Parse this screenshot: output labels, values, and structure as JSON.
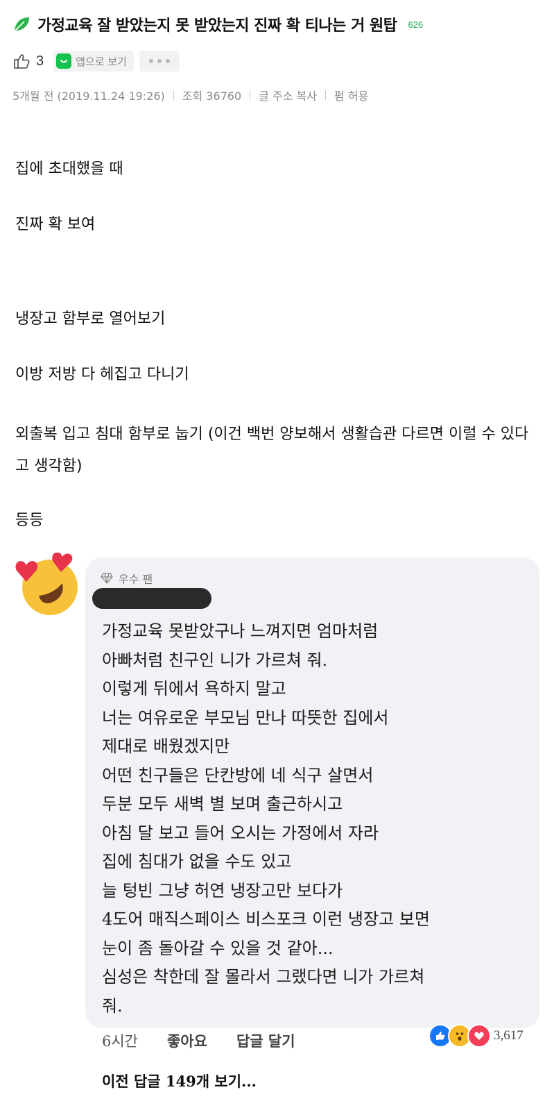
{
  "post": {
    "title": "가정교육 잘 받았는지 못 받았는지 진짜 확 티나는 거 원탑",
    "title_count": "626",
    "like_count": "3",
    "app_view_label": "앱으로 보기",
    "meta": {
      "time": "5개월 전 (2019.11.24 19:26)",
      "views": "조회 36760",
      "copy_link": "글 주소 복사",
      "share_permission": "펌 허용"
    },
    "body": {
      "p1": "집에 초대했을 때",
      "p2": "진짜 확 보여",
      "p3": "냉장고 함부로 열어보기",
      "p4": "이방 저방 다 헤집고 다니기",
      "p5": "외출복 입고 침대 함부로 눕기 (이건 백번 양보해서 생활습관 다르면 이럴 수 있다고 생각함)",
      "p6": "등등"
    }
  },
  "comment": {
    "badge": "우수 팬",
    "text": "가정교육 못받았구나 느껴지면 엄마처럼\n아빠처럼 친구인 니가 가르쳐 줘.\n이렇게 뒤에서 욕하지 말고\n너는 여유로운 부모님 만나 따뜻한 집에서\n제대로 배웠겠지만\n어떤 친구들은 단칸방에 네 식구 살면서\n두분 모두 새벽 별 보며 출근하시고\n아침 달 보고 들어 오시는 가정에서 자라\n집에 침대가 없을 수도 있고\n늘 텅빈 그냥 허연 냉장고만 보다가\n4도어 매직스페이스 비스포크 이런 냉장고 보면\n눈이 좀 돌아갈 수 있을 것 같아...\n심성은 착한데 잘 몰라서 그랬다면 니가 가르쳐\n줘.",
    "time": "6시간",
    "like_label": "좋아요",
    "reply_label": "답글 달기",
    "reaction_count": "3,617",
    "previous_replies": "이전 답글 149개 보기..."
  },
  "icons": {
    "leaf": "leaf-icon",
    "thumbs_up": "thumbs-up-icon",
    "app": "app-icon",
    "more": "more-icon",
    "diamond": "diamond-icon",
    "avatar": "heart-eyes-emoji",
    "reactions": [
      "like-reaction",
      "wow-reaction",
      "love-reaction"
    ]
  },
  "colors": {
    "leaf_green": "#1aa84a",
    "app_green": "#15c24e",
    "bubble_bg": "#f0f2f5",
    "like_blue": "#1877f2",
    "love_red": "#f33e58",
    "wow_yellow": "#f7b928"
  }
}
